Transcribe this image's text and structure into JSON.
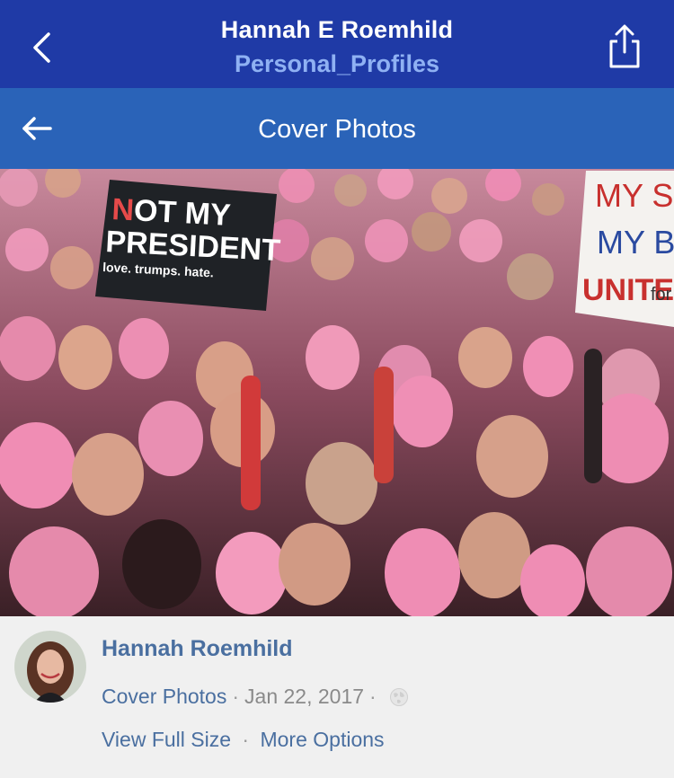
{
  "nav": {
    "title": "Hannah E Roemhild",
    "subtitle": "Personal_Profiles",
    "back_icon": "chevron-left-icon",
    "share_icon": "share-icon",
    "bg_color": "#1f3aa6",
    "subtitle_color": "#8fb1f3"
  },
  "subnav": {
    "title": "Cover Photos",
    "back_icon": "arrow-left-icon",
    "bg_color": "#2a63b8"
  },
  "photo": {
    "signs": {
      "left_line1_a": "N",
      "left_line1_b": "OT MY",
      "left_line2": "PRESIDENT",
      "left_line3": "love. trumps. hate.",
      "right_line1": "MY S",
      "right_line2": "MY B",
      "right_line3": "UNITE",
      "right_line3_b": "for"
    }
  },
  "post": {
    "author": "Hannah Roemhild",
    "album": "Cover Photos",
    "date": "Jan 22, 2017",
    "privacy_icon": "globe-icon",
    "view_full_size": "View Full Size",
    "more_options": "More Options",
    "link_color": "#4a6fa0"
  }
}
